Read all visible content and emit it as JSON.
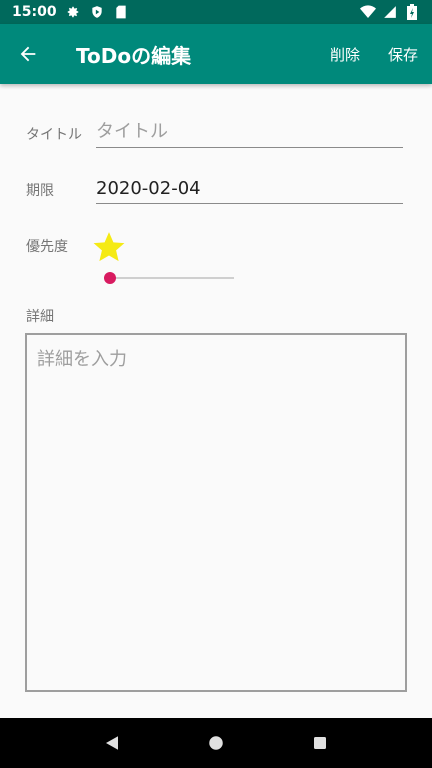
{
  "status_bar": {
    "time": "15:00"
  },
  "app_bar": {
    "title": "ToDoの編集",
    "delete_label": "削除",
    "save_label": "保存"
  },
  "form": {
    "title_label": "タイトル",
    "title_placeholder": "タイトル",
    "deadline_label": "期限",
    "deadline_value": "2020-02-04",
    "priority_label": "優先度",
    "priority_level": 0,
    "detail_label": "詳細",
    "detail_placeholder": "詳細を入力"
  },
  "colors": {
    "status_bar": "#00695c",
    "app_bar": "#00897b",
    "slider_thumb": "#d81b60",
    "star": "#f5ea14"
  }
}
